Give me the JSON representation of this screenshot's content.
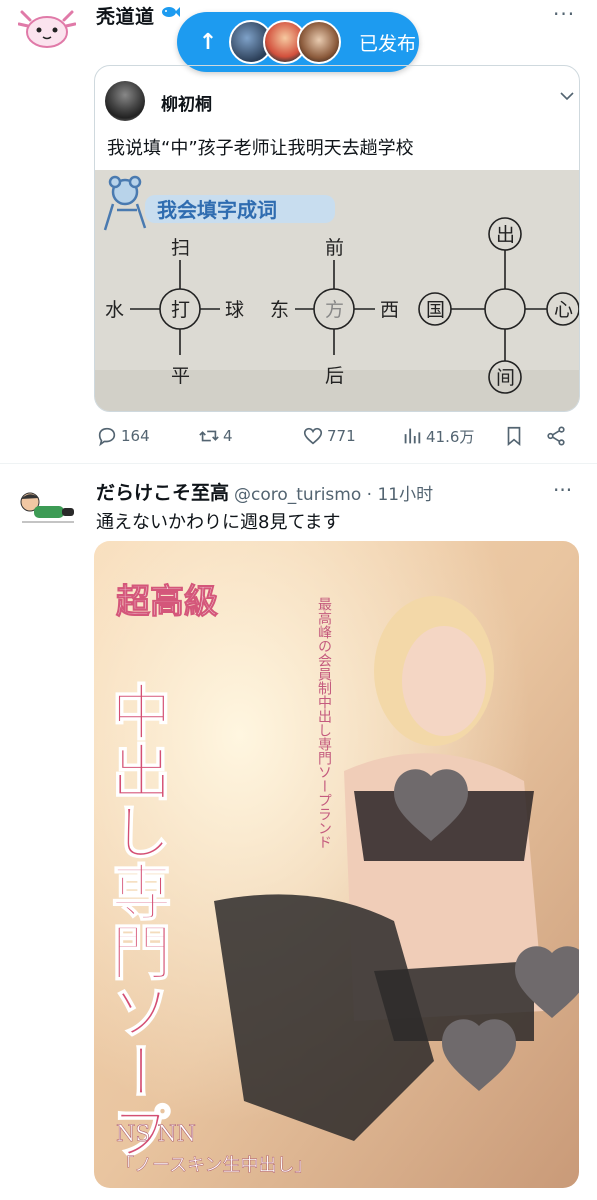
{
  "tweet1": {
    "display_name": "秃道道",
    "name_badge_icon": "fish-icon",
    "more_icon": "more-dots-icon"
  },
  "posted_pill": {
    "label": "已发布",
    "arrow_icon": "arrow-up-icon"
  },
  "quote": {
    "author_name": "柳初桐",
    "text": "我说填“中”孩子老师让我明天去趟学校",
    "image": {
      "title": "我会填字成词",
      "diagram1": {
        "center": "打",
        "top": "扫",
        "left": "水",
        "right": "球",
        "bottom": "平"
      },
      "diagram2": {
        "center": "方",
        "top": "前",
        "left": "东",
        "right": "西",
        "bottom": "后"
      },
      "diagram3": {
        "center": "",
        "top": "出",
        "left": "国",
        "right": "心",
        "bottom": "间"
      }
    }
  },
  "actions": {
    "replies": "164",
    "reposts": "4",
    "likes": "771",
    "views": "41.6万"
  },
  "tweet2": {
    "display_name": "だらけこそ至高",
    "handle": "@coro_turismo · 11小时",
    "text": "通えないかわりに週8見てます",
    "image": {
      "title_top": "超高級",
      "title_main": "中出し専門ソープ",
      "subtitle": "「ノースキン生中出し」",
      "vertical_copy": "最高峰の会員制中出し専門ソープランド",
      "badge": "NS NN"
    }
  },
  "colors": {
    "accent": "#1d9bf0",
    "text": "#0f1419",
    "secondary": "#536471",
    "border": "#cfd9de"
  }
}
